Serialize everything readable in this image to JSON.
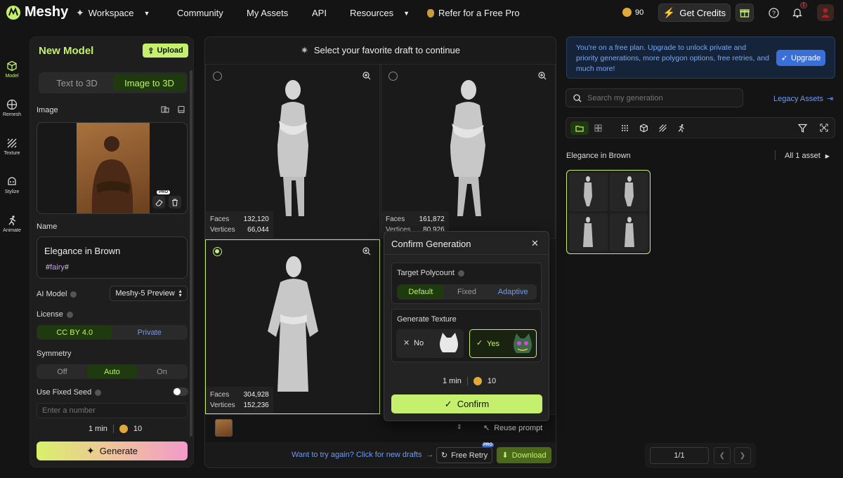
{
  "topbar": {
    "logo": "Meshy",
    "workspace": "Workspace",
    "community": "Community",
    "my_assets": "My Assets",
    "api": "API",
    "resources": "Resources",
    "refer": "Refer for a Free Pro",
    "credits": "90",
    "get_credits": "Get Credits",
    "notification_count": "1"
  },
  "rail": [
    "Model",
    "Remesh",
    "Texture",
    "Stylize",
    "Animate"
  ],
  "panel": {
    "title": "New Model",
    "upload": "Upload",
    "tabs": [
      "Text to 3D",
      "Image to 3D"
    ],
    "active_tab": "Image to 3D",
    "image_label": "Image",
    "pro_badge": "PRO",
    "name_label": "Name",
    "name_value": "Elegance in Brown",
    "tag_hash_open": "#",
    "tag": "fairy",
    "tag_hash_close": "#",
    "ai_model_label": "AI Model",
    "ai_model_value": "Meshy-5 Preview",
    "license_label": "License",
    "license_options": [
      "CC BY 4.0",
      "Private"
    ],
    "symmetry_label": "Symmetry",
    "symmetry_options": [
      "Off",
      "Auto",
      "On"
    ],
    "fixed_seed_label": "Use Fixed Seed",
    "seed_placeholder": "Enter a number",
    "time": "1 min",
    "cost": "10",
    "generate": "Generate"
  },
  "center": {
    "header": "Select your favorite draft to continue",
    "drafts": [
      {
        "faces_label": "Faces",
        "faces": "132,120",
        "vertices_label": "Vertices",
        "vertices": "66,044",
        "selected": false
      },
      {
        "faces_label": "Faces",
        "faces": "161,872",
        "vertices_label": "Vertices",
        "vertices": "80,926",
        "selected": false
      },
      {
        "faces_label": "Faces",
        "faces": "304,928",
        "vertices_label": "Vertices",
        "vertices": "152,236",
        "selected": true
      }
    ],
    "reuse_prompt": "Reuse prompt",
    "try_again": "Want to try again? Click for new drafts",
    "free_retry": "Free Retry",
    "pro_badge": "PRO",
    "download": "Download"
  },
  "modal": {
    "title": "Confirm Generation",
    "polycount_label": "Target Polycount",
    "polycount_options": [
      "Default",
      "Fixed",
      "Adaptive"
    ],
    "texture_label": "Generate Texture",
    "no": "No",
    "yes": "Yes",
    "time": "1 min",
    "cost": "10",
    "confirm": "Confirm"
  },
  "right": {
    "banner": "You're on a free plan. Upgrade to unlock private and priority generations, more polygon options, free retries, and much more!",
    "upgrade": "Upgrade",
    "search_placeholder": "Search my generation",
    "legacy": "Legacy Assets",
    "group_title": "Elegance in Brown",
    "all_assets": "All 1 asset",
    "page": "1/1"
  },
  "colors": {
    "accent": "#c4f06e",
    "blue": "#3b6fd8",
    "bg": "#141414"
  }
}
